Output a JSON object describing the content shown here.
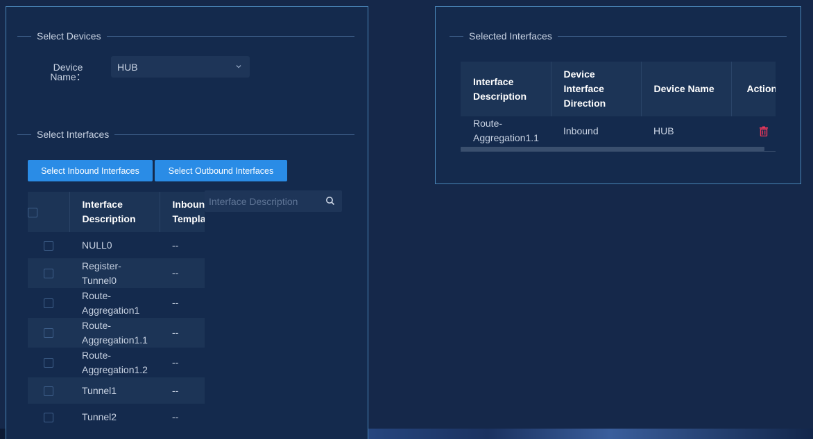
{
  "left_panel": {
    "select_devices_title": "Select Devices",
    "device_label_line1": "Device",
    "device_label_line2": "Name：",
    "device_value": "HUB",
    "select_interfaces_title": "Select Interfaces",
    "btn_inbound": "Select Inbound Interfaces",
    "btn_outbound": "Select Outbound Interfaces",
    "search_placeholder": "Interface Description",
    "table": {
      "col_interface_line1": "Interface",
      "col_interface_line2": "Description",
      "col_inbound_line1": "Inbound",
      "col_inbound_line2": "Template",
      "rows": [
        {
          "l1": "NULL0",
          "l2": "",
          "tpl": "--"
        },
        {
          "l1": "Register-",
          "l2": "Tunnel0",
          "tpl": "--"
        },
        {
          "l1": "Route-",
          "l2": "Aggregation1",
          "tpl": "--"
        },
        {
          "l1": "Route-",
          "l2": "Aggregation1.1",
          "tpl": "--"
        },
        {
          "l1": "Route-",
          "l2": "Aggregation1.2",
          "tpl": "--"
        },
        {
          "l1": "Tunnel1",
          "l2": "",
          "tpl": "--"
        },
        {
          "l1": "Tunnel2",
          "l2": "",
          "tpl": "--"
        }
      ]
    }
  },
  "right_panel": {
    "title": "Selected Interfaces",
    "table": {
      "col1_line1": "Interface",
      "col1_line2": "Description",
      "col2_line1": "Device",
      "col2_line2": "Interface",
      "col2_line3": "Direction",
      "col3": "Device Name",
      "col4": "Action",
      "rows": [
        {
          "desc_l1": "Route-",
          "desc_l2": "Aggregation1.1",
          "direction": "Inbound",
          "device": "HUB"
        }
      ]
    }
  },
  "colors": {
    "background": "#15284a",
    "button": "#2a8ce6",
    "delete": "#e8375b",
    "panel_border": "#4a86b8"
  }
}
